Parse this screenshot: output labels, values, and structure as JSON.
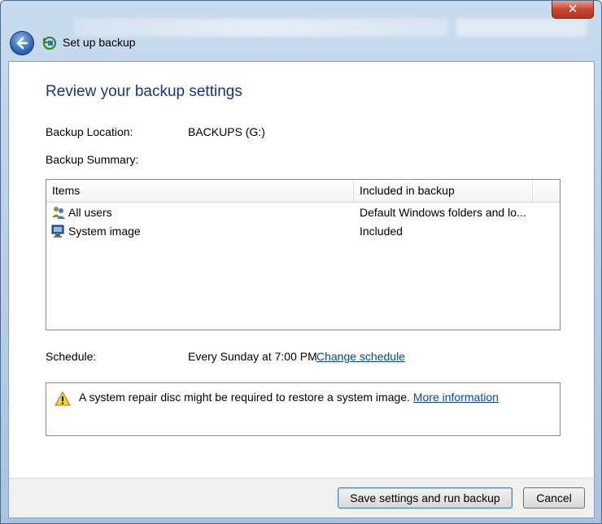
{
  "window": {
    "title": "Set up backup",
    "close_label": "✕"
  },
  "main": {
    "heading": "Review your backup settings",
    "backup_location_label": "Backup Location:",
    "backup_location_value": "BACKUPS (G:)",
    "backup_summary_label": "Backup Summary:",
    "table": {
      "columns": [
        "Items",
        "Included in backup"
      ],
      "rows": [
        {
          "icon": "users-icon",
          "item": "All users",
          "included": "Default Windows folders and lo..."
        },
        {
          "icon": "computer-icon",
          "item": "System image",
          "included": "Included"
        }
      ]
    },
    "schedule_label": "Schedule:",
    "schedule_value": "Every Sunday at 7:00 PM",
    "change_schedule_link": "Change schedule",
    "notice_text": "A system repair disc might be required to restore a system image.",
    "more_information_link": "More information"
  },
  "footer": {
    "save_button": "Save settings and run backup",
    "cancel_button": "Cancel"
  },
  "colors": {
    "heading": "#1e3287",
    "link": "#0645ad",
    "titlebar": "#a9c3df"
  }
}
